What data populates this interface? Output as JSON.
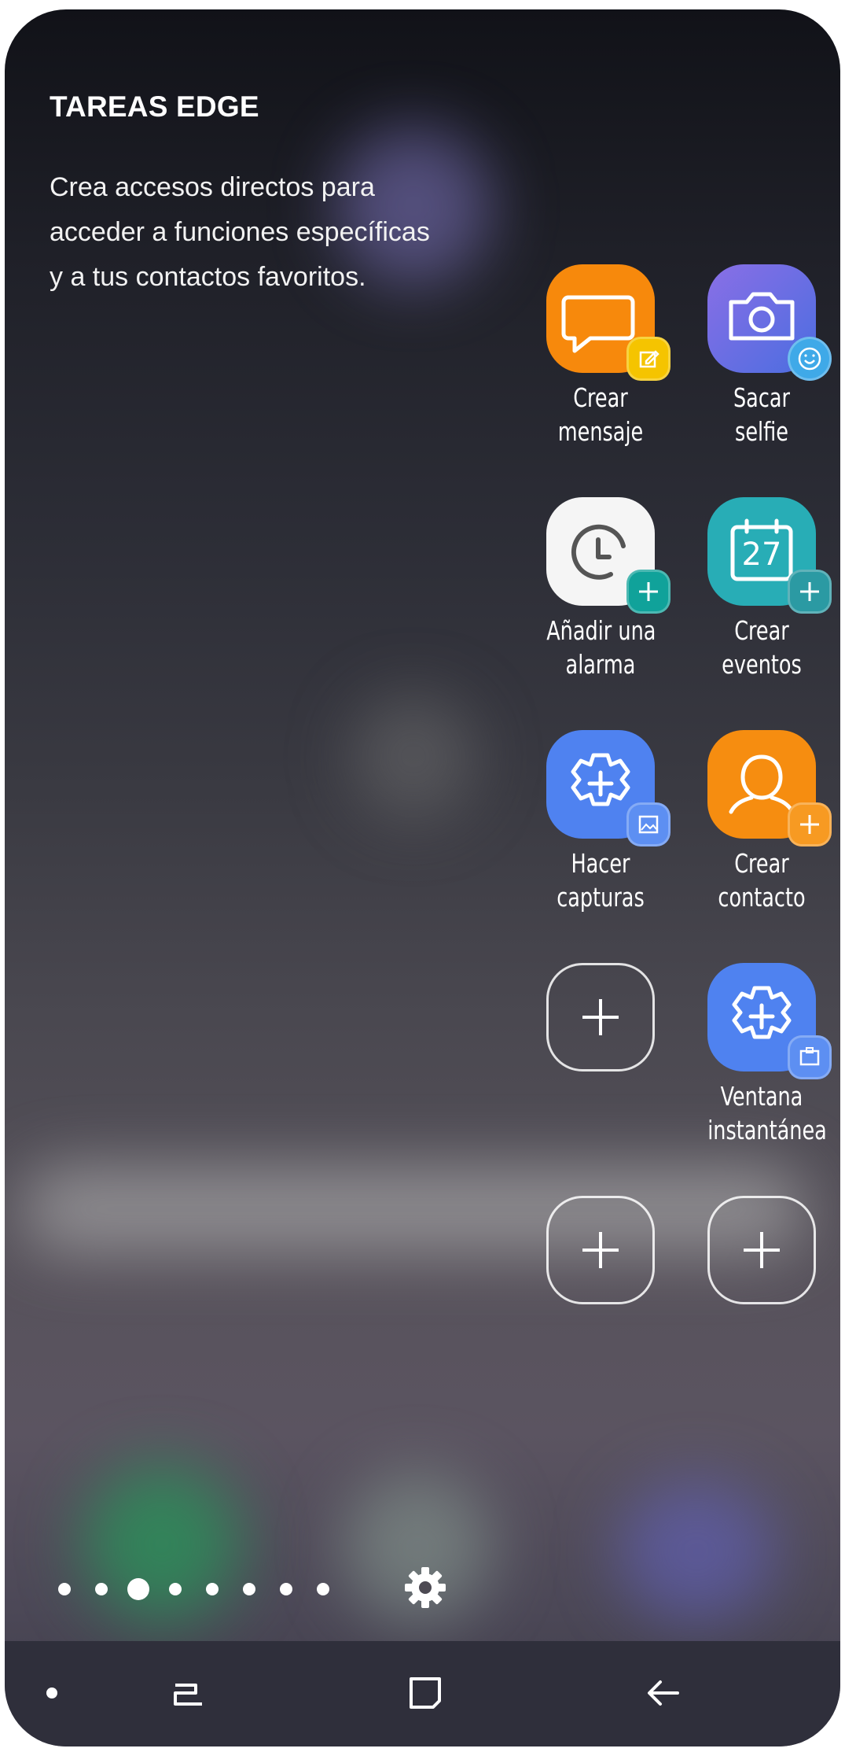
{
  "panel": {
    "title": "TAREAS EDGE",
    "description_lines": [
      "Crea accesos directos para",
      "acceder a funciones específicas",
      "y a tus contactos favoritos."
    ]
  },
  "tasks": [
    {
      "label_lines": [
        "Crear",
        "mensaje"
      ],
      "icon": "message-compose-icon",
      "color": "#f7890c",
      "badge_color": "#f5c400"
    },
    {
      "label_lines": [
        "Sacar",
        "selfie"
      ],
      "icon": "camera-selfie-icon",
      "color": "#6d73e8",
      "badge_color": "#3fa9e8"
    },
    {
      "label_lines": [
        "Añadir una",
        "alarma"
      ],
      "icon": "alarm-add-icon",
      "color": "#f5f5f5",
      "badge_color": "#10a29a"
    },
    {
      "label_lines": [
        "Crear",
        "eventos"
      ],
      "icon": "calendar-event-icon",
      "calendar_day": "27",
      "color": "#28adb6",
      "badge_color": "#2b9aa3"
    },
    {
      "label_lines": [
        "Hacer",
        "capturas"
      ],
      "icon": "screenshot-settings-icon",
      "color": "#4f82f0",
      "badge_color": "#5d8ff2"
    },
    {
      "label_lines": [
        "Crear",
        "contacto"
      ],
      "icon": "contact-add-icon",
      "color": "#f68d10",
      "badge_color": "#f79a22"
    },
    {
      "label_lines": [
        "",
        ""
      ],
      "icon": "add-icon",
      "empty": true
    },
    {
      "label_lines": [
        "Ventana",
        "instantánea"
      ],
      "icon": "popup-window-settings-icon",
      "color": "#4f82f0",
      "badge_color": "#5d8ff2"
    },
    {
      "label_lines": [
        "",
        ""
      ],
      "icon": "add-icon",
      "empty": true
    },
    {
      "label_lines": [
        "",
        ""
      ],
      "icon": "add-icon",
      "empty": true
    }
  ],
  "page_indicator": {
    "count": 8,
    "current": 3
  },
  "settings": {
    "icon": "gear-icon"
  },
  "navigation": {
    "items": [
      {
        "name": "dot-indicator",
        "icon": "dot-icon"
      },
      {
        "name": "recent-apps",
        "icon": "recent-apps-icon"
      },
      {
        "name": "home",
        "icon": "home-icon"
      },
      {
        "name": "back",
        "icon": "back-arrow-icon"
      }
    ],
    "bar_color": "#2f2f3b"
  }
}
